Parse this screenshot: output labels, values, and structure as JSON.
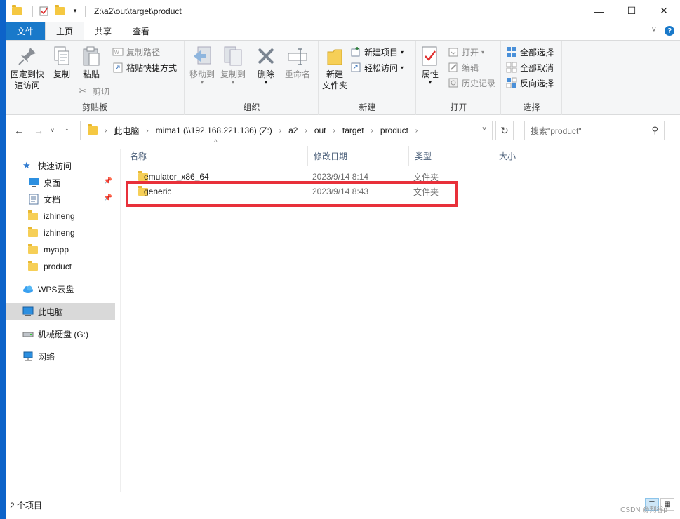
{
  "window": {
    "title": "Z:\\a2\\out\\target\\product",
    "controls": {
      "minimize": "—",
      "maximize": "☐",
      "close": "✕"
    }
  },
  "tabs": [
    {
      "label": "文件"
    },
    {
      "label": "主页"
    },
    {
      "label": "共享"
    },
    {
      "label": "查看"
    }
  ],
  "tabs_right": {
    "collapse": "˅",
    "help": "?"
  },
  "ribbon": {
    "clipboard": {
      "label": "剪贴板",
      "pin_line1": "固定到快",
      "pin_line2": "速访问",
      "copy": "复制",
      "paste": "粘贴",
      "copy_path": "复制路径",
      "paste_shortcut": "粘贴快捷方式",
      "cut": "剪切"
    },
    "organize": {
      "label": "组织",
      "move_to": "移动到",
      "copy_to": "复制到",
      "delete": "删除",
      "rename": "重命名"
    },
    "new": {
      "label": "新建",
      "new_folder_line1": "新建",
      "new_folder_line2": "文件夹",
      "new_item": "新建项目",
      "easy_access": "轻松访问"
    },
    "open": {
      "label": "打开",
      "properties": "属性",
      "open": "打开",
      "edit": "编辑",
      "history": "历史记录"
    },
    "select": {
      "label": "选择",
      "select_all": "全部选择",
      "select_none": "全部取消",
      "invert": "反向选择"
    }
  },
  "address": {
    "crumbs": [
      "此电脑",
      "mima1 (\\\\192.168.221.136) (Z:)",
      "a2",
      "out",
      "target",
      "product"
    ],
    "search_placeholder": "搜索\"product\""
  },
  "nav_pane": {
    "quick_access": "快速访问",
    "items": [
      {
        "label": "桌面",
        "pinned": true
      },
      {
        "label": "文档",
        "pinned": true
      },
      {
        "label": "izhineng"
      },
      {
        "label": "izhineng"
      },
      {
        "label": "myapp"
      },
      {
        "label": "product"
      }
    ],
    "wps": "WPS云盘",
    "this_pc": "此电脑",
    "drive": "机械硬盘 (G:)",
    "network": "网络"
  },
  "list": {
    "columns": [
      "名称",
      "修改日期",
      "类型",
      "大小"
    ],
    "rows": [
      {
        "name": "emulator_x86_64",
        "date": "2023/9/14 8:14",
        "type": "文件夹",
        "size": ""
      },
      {
        "name": "generic",
        "date": "2023/9/14 8:43",
        "type": "文件夹",
        "size": ""
      }
    ]
  },
  "status": {
    "count": "2 个项目"
  },
  "watermark": "CSDN @刻谷p",
  "colors": {
    "accent": "#1979ca",
    "highlight_box": "#e8303a",
    "folder": "#f6cf57"
  }
}
